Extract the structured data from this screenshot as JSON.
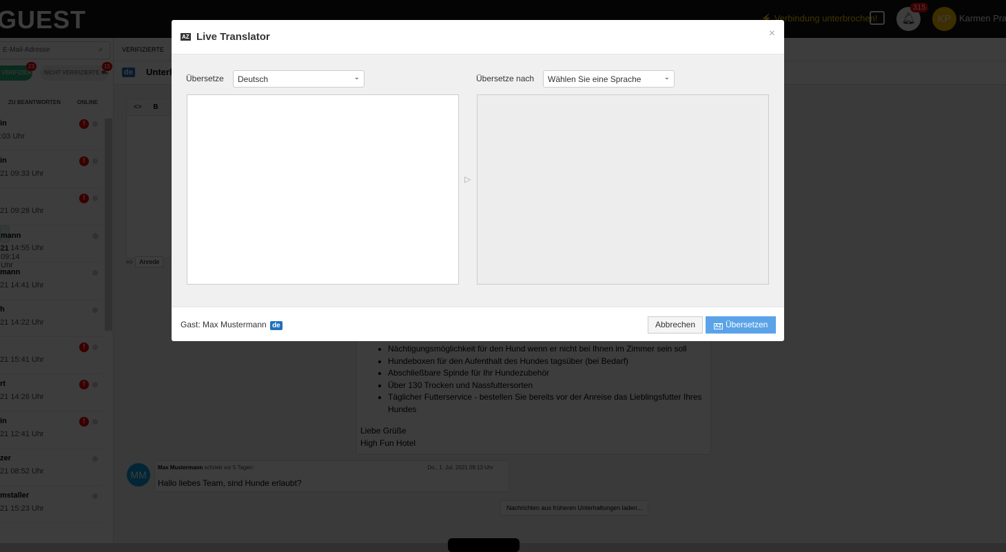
{
  "header": {
    "logo": "GUEST",
    "connection_status": "⚡ Verbindung unterbrochen!",
    "notification_count": "315",
    "user_initials": "KP",
    "user_name": "Karmen Pram"
  },
  "sidebar": {
    "search_placeholder": "E-Mail-Adresse",
    "verified_label": "VERIFIZIERTE ⛟",
    "verified_count": "23",
    "unverified_label": "NICHT VERIFIZIERTE ⛟",
    "unverified_count": "15",
    "tabs": [
      "ZU BEANTWORTEN",
      "ONLINE"
    ],
    "items": [
      {
        "name": "in",
        "time": ":03 Uhr",
        "warn": true
      },
      {
        "name": "in",
        "time": "21 09:33 Uhr",
        "warn": true
      },
      {
        "name": "",
        "time": "21 09:28 Uhr",
        "warn": true
      },
      {
        "name": "mann",
        "time": "21 09:14 Uhr",
        "warn": false
      },
      {
        "name": "",
        "time": "21 14:55 Uhr",
        "warn": false
      },
      {
        "name": "mann",
        "time": "21 14:41 Uhr",
        "warn": false
      },
      {
        "name": "h",
        "time": "21 14:22 Uhr",
        "warn": false
      },
      {
        "name": "",
        "time": "21 15:41 Uhr",
        "warn": true
      },
      {
        "name": "rt",
        "time": "21 14:26 Uhr",
        "warn": true
      },
      {
        "name": "in",
        "time": "21 12:41 Uhr",
        "warn": true
      },
      {
        "name": "zer",
        "time": "21 08:52 Uhr",
        "warn": false
      },
      {
        "name": "mstaller",
        "time": "21 15:23 Uhr",
        "warn": false
      }
    ]
  },
  "main": {
    "tab_verified": "VERIFIZIERTE",
    "lang_tag": "de",
    "conversation_title": "Unterh",
    "editor_toolbar": [
      "<>",
      "B"
    ],
    "anrede_label": "Anrede",
    "hotel_message": {
      "bullets": [
        "Nächtigungsmöglichkeit für den Hund wenn er nicht bei Ihnen im Zimmer sein soll",
        "Hundeboxen für den Aufenthalt des Hundes tagsüber (bei Bedarf)",
        "Abschließbare Spinde für Ihr Hundezubehör",
        "Über 130 Trocken und Nassfuttersorten",
        "Täglicher Futterservice - bestellen Sie bereits vor der Anreise das Lieblingsfutter Ihres Hundes"
      ],
      "greeting": "Liebe Grüße",
      "signature": "High Fun Hotel"
    },
    "guest_message": {
      "initials": "MM",
      "author": "Max Mustermann",
      "meta": " schrieb vor 5 Tagen:",
      "date": "Do., 1. Jul. 2021 09:13 Uhr",
      "text": "Hallo liebes Team, sind Hunde erlaubt?"
    },
    "load_more": "Nachrichten aus früheren Unterhaltungen laden..."
  },
  "modal": {
    "icon": "AZ",
    "title": "Live Translator",
    "close": "×",
    "source_label": "Übersetze",
    "source_lang": "Deutsch",
    "target_label": "Übersetze nach",
    "target_lang": "Wählen Sie eine Sprache",
    "source_text": "",
    "target_text": "",
    "guest_label": "Gast: Max Mustermann",
    "guest_lang": "de",
    "cancel": "Abbrechen",
    "translate": "Übersetzen"
  }
}
